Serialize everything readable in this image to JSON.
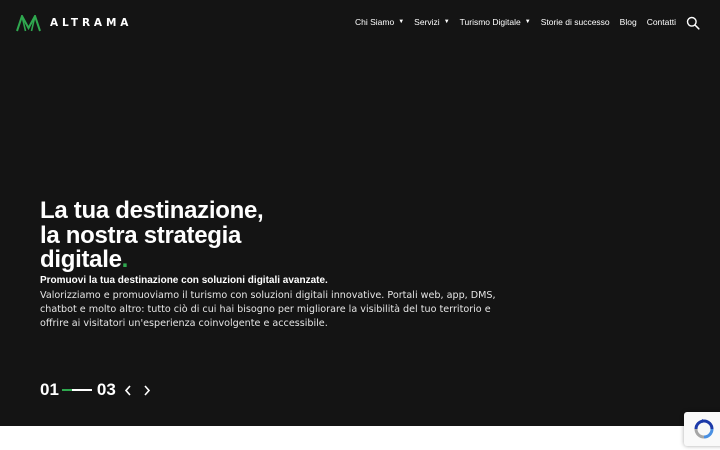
{
  "brand": {
    "name": "ALTRAMA",
    "logo_icon": "altrama-m-mark",
    "accent_color": "#2fa84f"
  },
  "nav": {
    "items": [
      {
        "label": "Chi Siamo",
        "has_dropdown": true
      },
      {
        "label": "Servizi",
        "has_dropdown": true
      },
      {
        "label": "Turismo Digitale",
        "has_dropdown": true
      },
      {
        "label": "Storie di successo",
        "has_dropdown": false
      },
      {
        "label": "Blog",
        "has_dropdown": false
      },
      {
        "label": "Contatti",
        "has_dropdown": false
      }
    ],
    "dropdown_caret": "▼",
    "search_icon": "search-icon"
  },
  "hero": {
    "background_color": "#141414",
    "headline_lines": [
      "La tua destinazione,",
      "la nostra strategia",
      "digitale"
    ],
    "headline_dot": ".",
    "subtitle": "Promuovi la tua destinazione con soluzioni digitali avanzate.",
    "body": "Valorizziamo e promuoviamo il turismo con soluzioni digitali innovative. Portali web, app, DMS, chatbot e molto altro: tutto ciò di cui hai bisogno per migliorare la visibilità del tuo territorio e offrire ai visitatori un'esperienza coinvolgente e accessibile."
  },
  "slider": {
    "current": "01",
    "total": "03",
    "progress_fraction": 0.33,
    "prev_icon": "chevron-left-icon",
    "next_icon": "chevron-right-icon"
  },
  "recaptcha": {
    "icon": "recaptcha-icon"
  }
}
